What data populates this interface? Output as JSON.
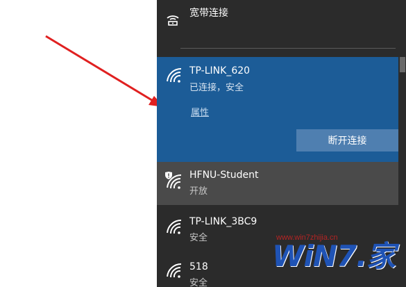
{
  "networks": {
    "broadband": {
      "name": "宽带连接"
    },
    "connected": {
      "name": "TP-LINK_620",
      "status": "已连接，安全",
      "properties_label": "属性",
      "disconnect_label": "断开连接"
    },
    "list": [
      {
        "name": "HFNU-Student",
        "status": "开放",
        "icon": "wifi-shield-icon"
      },
      {
        "name": "TP-LINK_3BC9",
        "status": "安全",
        "icon": "wifi-icon"
      },
      {
        "name": "518",
        "status": "安全",
        "icon": "wifi-icon"
      }
    ]
  },
  "watermark": {
    "url": "www.win7zhijia.cn",
    "logo_text": "WiN7.家"
  },
  "colors": {
    "panel_bg": "#2b2b2b",
    "connected_bg": "#1c5c97",
    "hover_bg": "#4a4a4a",
    "button_bg": "#4f7fb0",
    "arrow": "#e02020"
  }
}
